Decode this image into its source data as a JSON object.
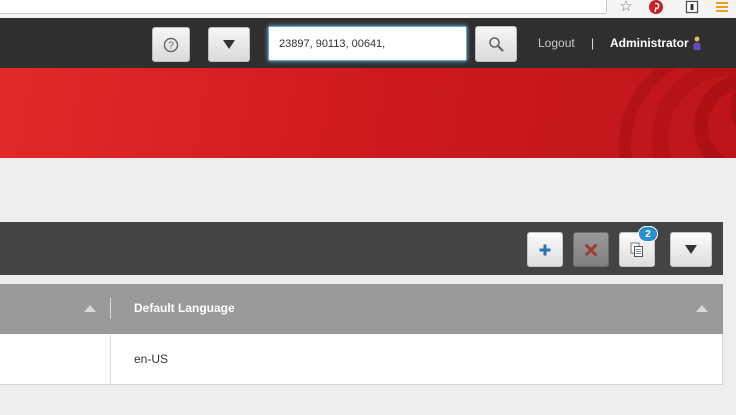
{
  "header": {
    "search": {
      "value": "23897, 90113, 00641,"
    },
    "logout_label": "Logout",
    "separator": "|",
    "user_label": "Administrator"
  },
  "toolbar": {
    "copy_badge_count": "2"
  },
  "table": {
    "columns": [
      {
        "label": ""
      },
      {
        "label": "Default Language"
      }
    ],
    "rows": [
      {
        "cells": [
          "",
          "en-US"
        ]
      }
    ]
  },
  "colors": {
    "banner_red": "#d11b1f",
    "topbar_dark": "#2f2f2f",
    "toolbar_dark": "#444444",
    "header_gray": "#9a9a9a",
    "badge_blue": "#2a8fd2",
    "add_blue": "#2b6fb6",
    "delete_red": "#a33a3a"
  },
  "icons": {
    "browser": [
      "star-icon",
      "pinterest-icon",
      "extension-icon",
      "browser-menu-icon"
    ],
    "header": [
      "help-icon",
      "dropdown-arrow-icon",
      "search-icon",
      "user-icon"
    ],
    "toolbar": [
      "add-icon",
      "delete-icon",
      "copy-icon",
      "dropdown-arrow-icon"
    ]
  }
}
